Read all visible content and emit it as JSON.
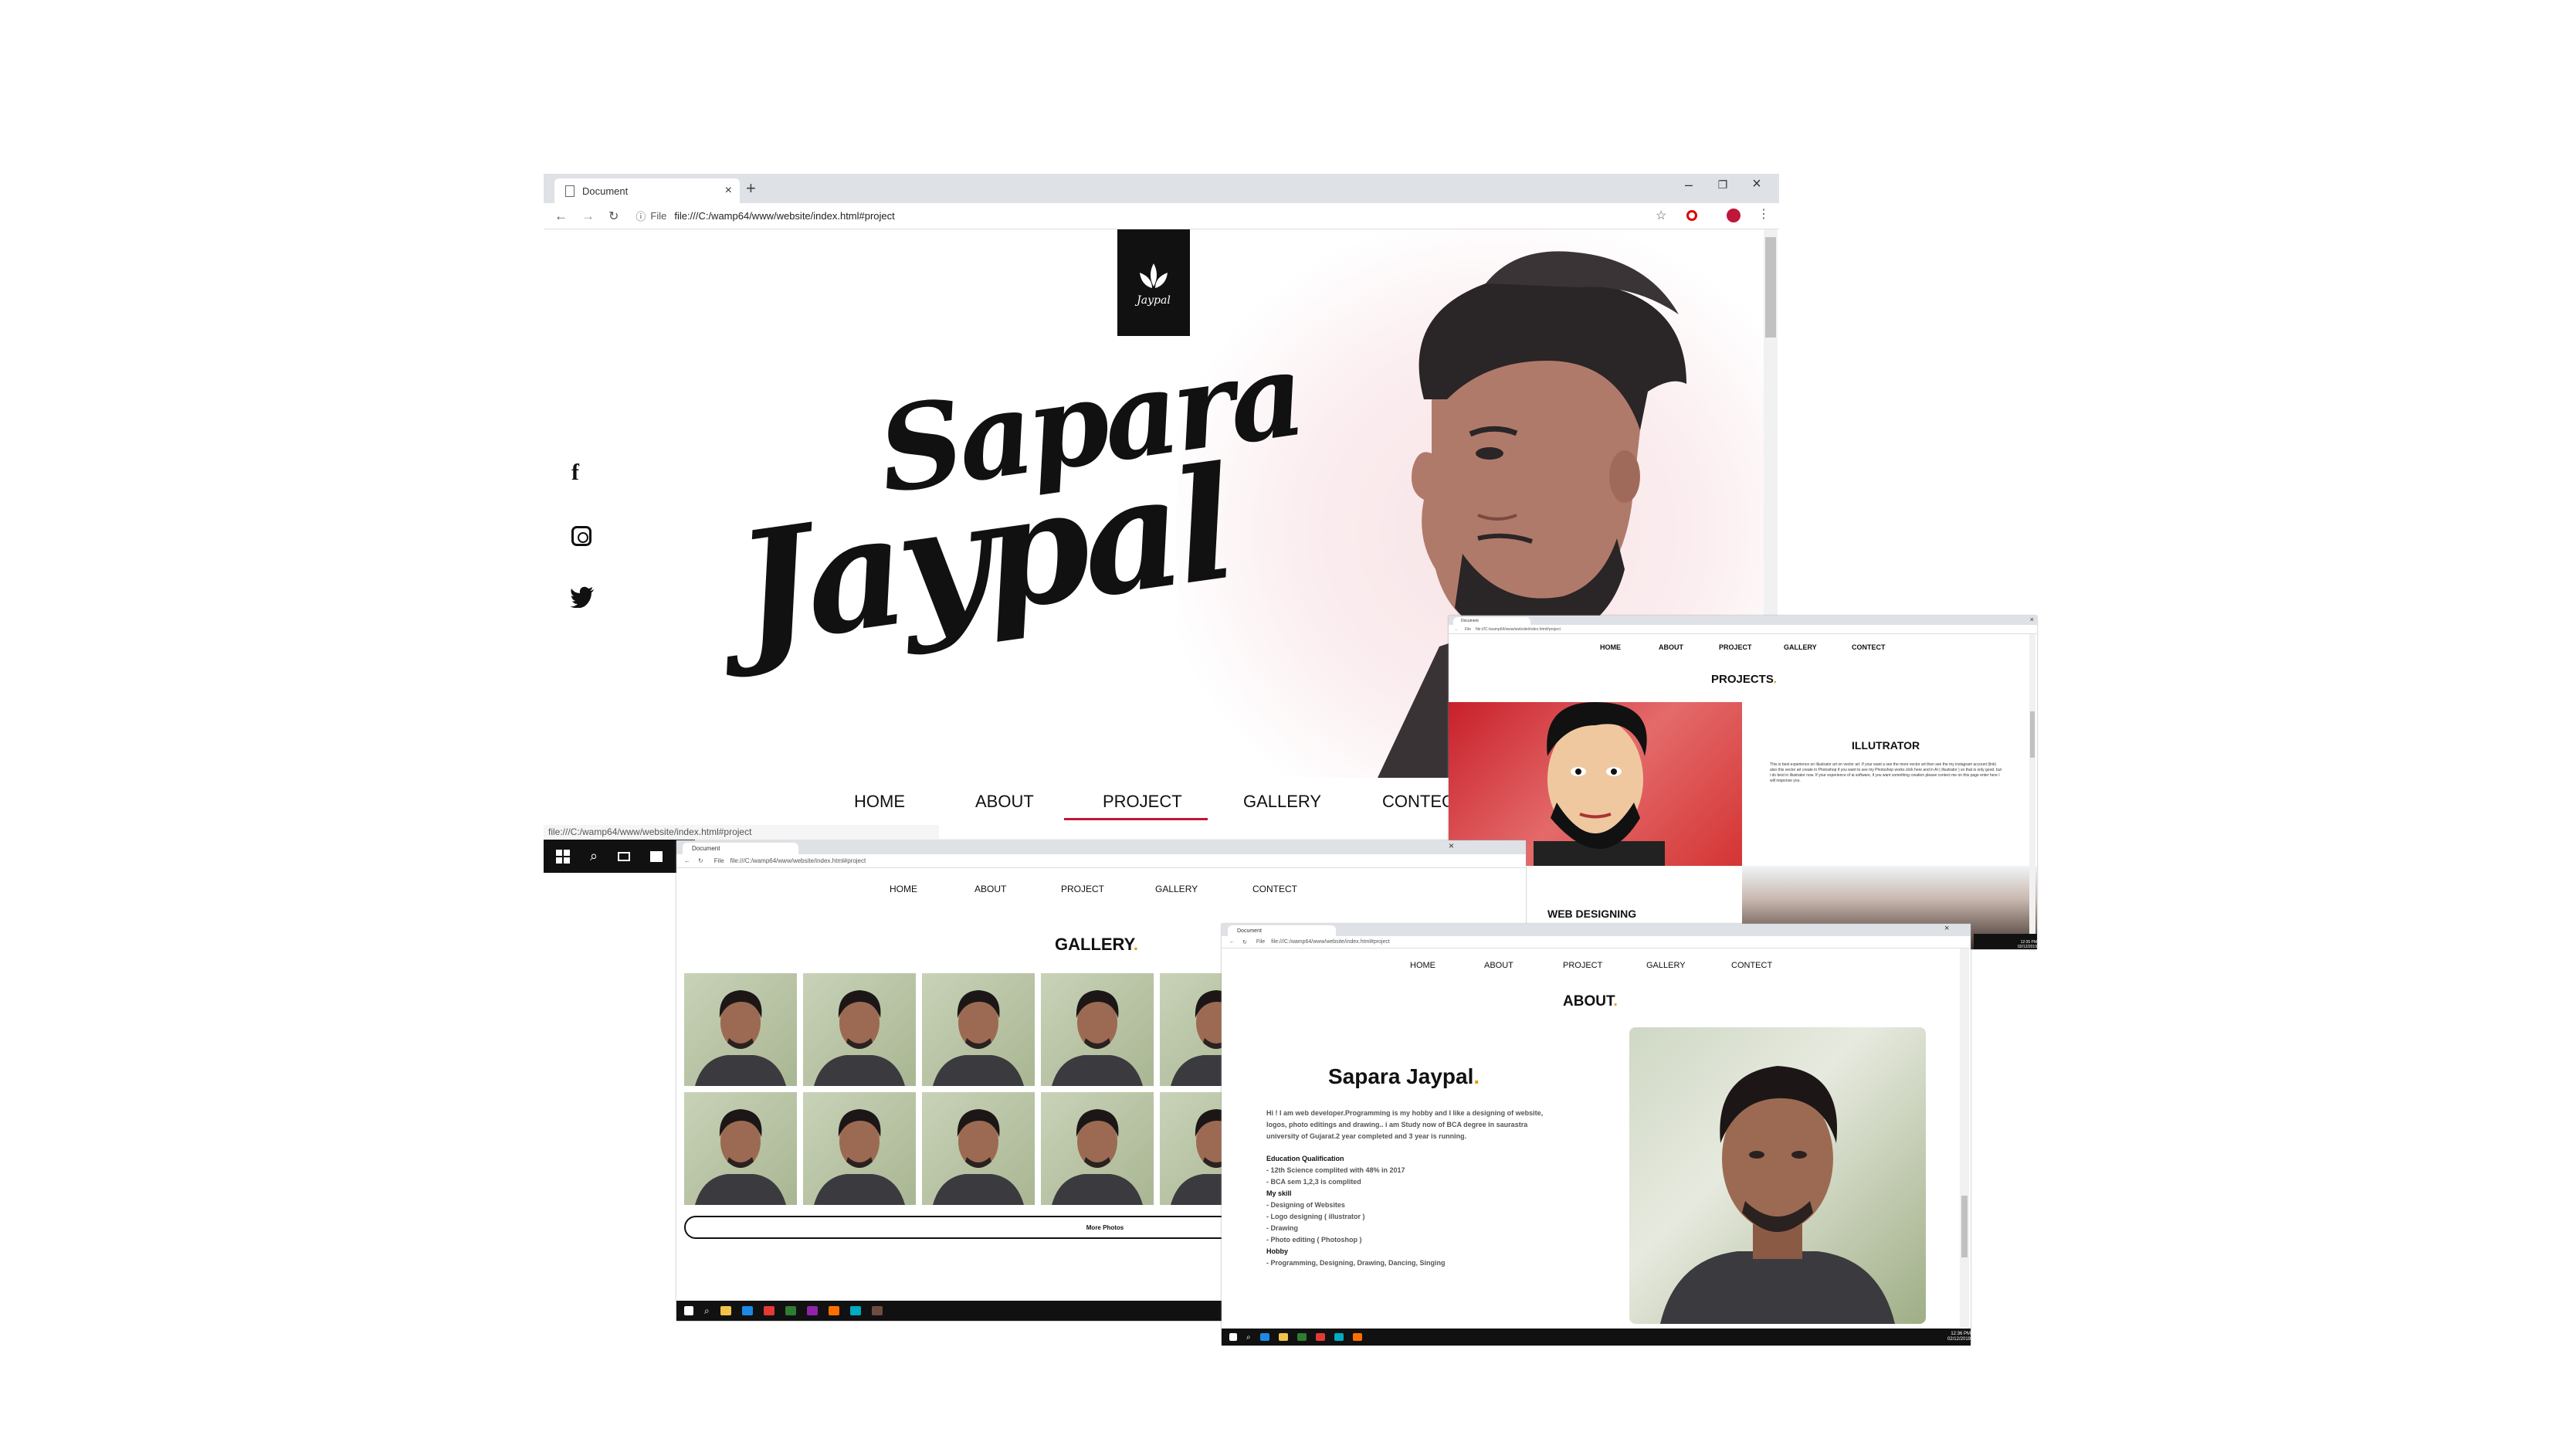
{
  "main_window": {
    "tab_title": "Document",
    "url": "file:///C:/wamp64/www/website/index.html#project",
    "file_label": "File",
    "status_url": "file:///C:/wamp64/www/website/index.html#project",
    "logo_text": "Jaypal",
    "hero_name_line1": "Sapara",
    "hero_name_line2": "Jaypal",
    "nav": [
      "HOME",
      "ABOUT",
      "PROJECT",
      "GALLERY",
      "CONTECT"
    ],
    "active_nav": "PROJECT"
  },
  "projects_window": {
    "tab_title": "Document",
    "url": "file:///C:/wamp64/www/website/index.html#project",
    "file_label": "File",
    "nav": [
      "HOME",
      "ABOUT",
      "PROJECT",
      "GALLERY",
      "CONTECT"
    ],
    "heading": "PROJECTS",
    "card1_title": "ILLUTRATOR",
    "card1_text": "This is best experience on illustrator art on vector art. If your want a see the more vector art then see the my instagram account (link) also this vector art create in Photoshop if you want to see my Photoshop works click here and in AI ( illustrator ) so that is only good. but i do best in illustrator now. If your experience of ai software, if you want something creation please contect me on this page enter here I will response you.",
    "card2_title": "WEB DESIGNING"
  },
  "gallery_window": {
    "tab_title": "Document",
    "url": "file:///C:/wamp64/www/website/index.html#project",
    "file_label": "File",
    "nav": [
      "HOME",
      "ABOUT",
      "PROJECT",
      "GALLERY",
      "CONTECT"
    ],
    "heading": "GALLERY",
    "more_button": "More Photos"
  },
  "about_window": {
    "tab_title": "Document",
    "url": "file:///C:/wamp64/www/website/index.html#project",
    "file_label": "File",
    "nav": [
      "HOME",
      "ABOUT",
      "PROJECT",
      "GALLERY",
      "CONTECT"
    ],
    "heading": "ABOUT",
    "name": "Sapara Jaypal",
    "intro": "Hi ! I am web developer.Programming is my hobby and I like a designing of website, logos, photo editings and drawing.. i am Study now of BCA degree in saurastra university of Gujarat.2 year completed and 3 year is running.",
    "edu_title": "Education Qualification",
    "edu_items": [
      "- 12th Science complited with 48% in 2017",
      "- BCA sem 1,2,3 is complited"
    ],
    "skill_title": "My skill",
    "skill_items": [
      "- Designing of Websites",
      "- Logo designing ( illustrator )",
      "- Drawing",
      "- Photo editing ( Photoshop )"
    ],
    "hobby_title": "Hobby",
    "hobby_items": [
      "- Programming, Designing, Drawing, Dancing, Singing"
    ],
    "clock_time": "12:36 PM",
    "clock_date": "02/12/2019"
  },
  "projects_clock": {
    "time": "12:35 PM",
    "date": "02/12/2019"
  },
  "colors": {
    "accent": "#e0a000",
    "active_underline": "#c0163a",
    "taskbar": "#111111",
    "tabbar": "#dee1e6"
  }
}
